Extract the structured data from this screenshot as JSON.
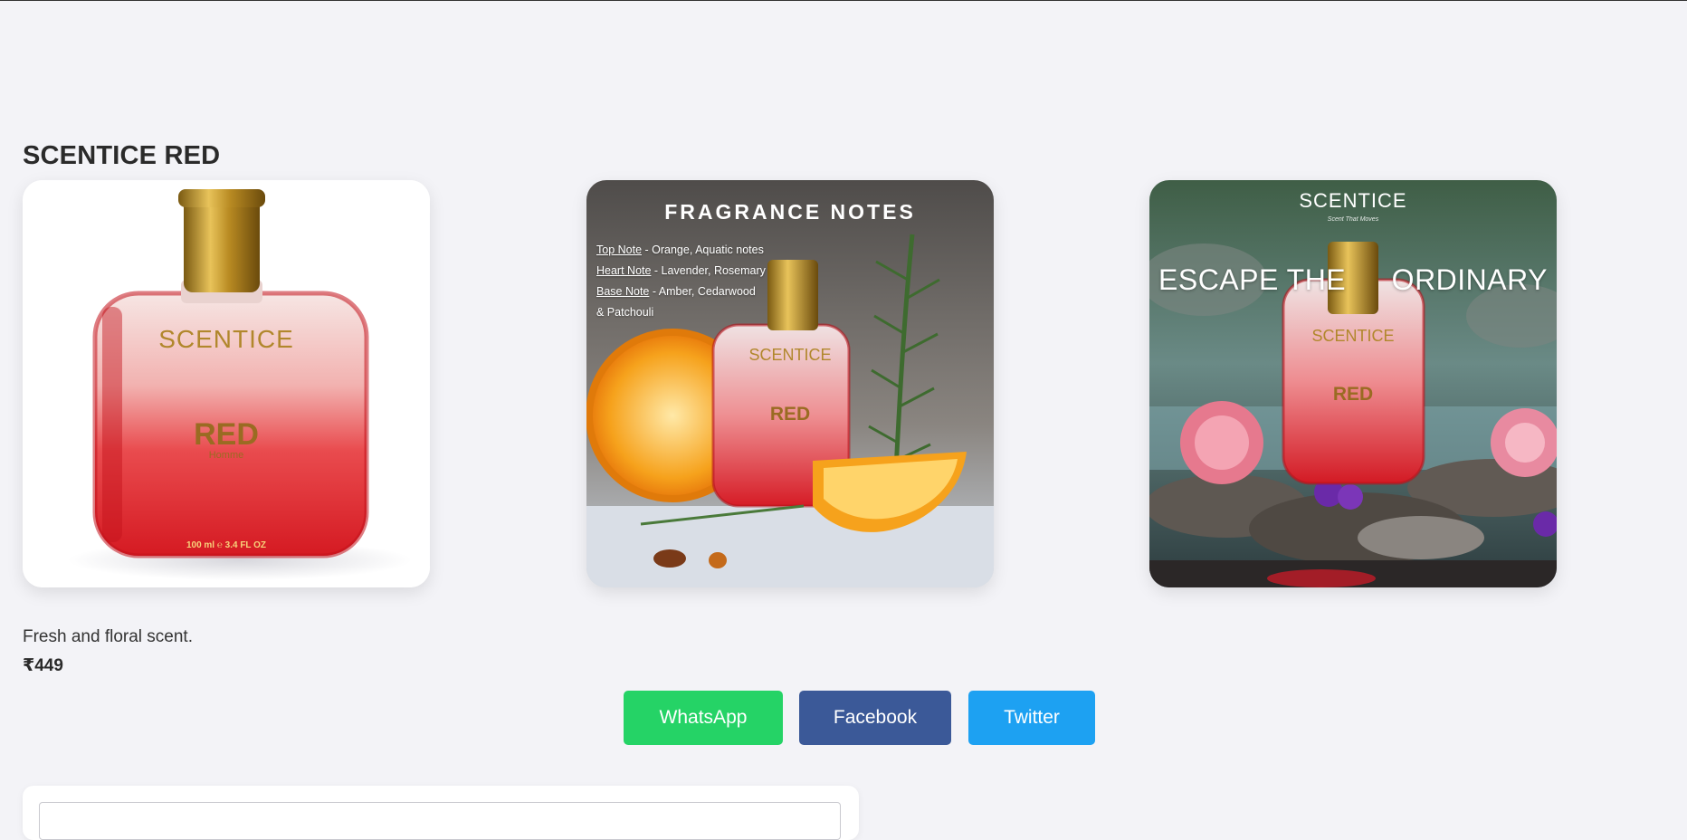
{
  "product": {
    "title": "SCENTICE RED",
    "description": "Fresh and floral scent.",
    "price": "₹449"
  },
  "images": {
    "bottle": {
      "brand": "SCENTICE",
      "name": "RED",
      "sub": "Homme",
      "volume": "100 ml ℮ 3.4 FL OZ"
    },
    "notes": {
      "heading": "FRAGRANCE NOTES",
      "lines": [
        {
          "key": "Top Note",
          "value": " - Orange, Aquatic notes"
        },
        {
          "key": "Heart Note",
          "value": " - Lavender, Rosemary"
        },
        {
          "key": "Base Note",
          "value": " - Amber, Cedarwood"
        },
        {
          "key": "",
          "value": "& Patchouli"
        }
      ]
    },
    "escape": {
      "brand": "SCENTICE",
      "tagline": "Scent That Moves",
      "left": "ESCAPE THE",
      "right": "ORDINARY"
    }
  },
  "share": {
    "whatsapp": "WhatsApp",
    "facebook": "Facebook",
    "twitter": "Twitter"
  },
  "colors": {
    "whatsapp": "#25d366",
    "facebook": "#3b5998",
    "twitter": "#1da1f2"
  }
}
